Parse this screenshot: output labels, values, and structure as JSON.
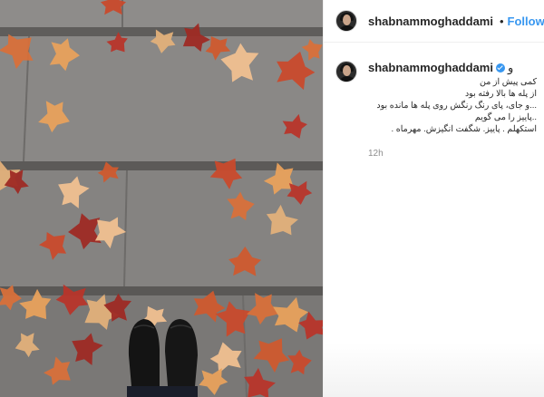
{
  "post": {
    "photo_alt": "photo-stairs-autumn-leaves",
    "header": {
      "username": "shabnammoghaddami",
      "dot": "•",
      "follow_label": "Follow"
    },
    "caption": {
      "username": "shabnammoghaddami",
      "first_word": "و",
      "lines": [
        "کمی پیش از من",
        "از پله ها بالا رفته بود",
        "...و جای، پای رنگ رنگش روی پله ها مانده بود",
        "..پاییز را می گویم",
        "استکهلم . پاییز. شگفت انگیزش. مهرماه ."
      ]
    },
    "time": "12h",
    "colors": {
      "accent": "#3897f0",
      "text": "#262626",
      "muted": "#8e8e8e"
    }
  }
}
